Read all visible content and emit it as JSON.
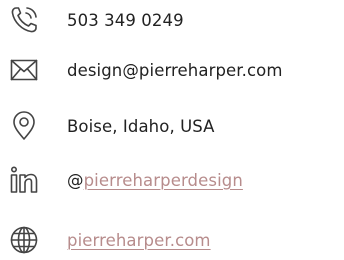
{
  "contact": {
    "phone": "503 349 0249",
    "email": "design@pierreharper.com",
    "location": "Boise, Idaho, USA",
    "linkedin_prefix": "@",
    "linkedin_handle": "pierreharperdesign",
    "website": "pierreharper.com"
  },
  "icons": {
    "phone": "phone-ringing-icon",
    "email": "envelope-icon",
    "location": "map-pin-icon",
    "linkedin": "linkedin-icon",
    "website": "globe-icon"
  },
  "colors": {
    "text": "#222222",
    "icon": "#444444",
    "link": "#b78c8c"
  }
}
